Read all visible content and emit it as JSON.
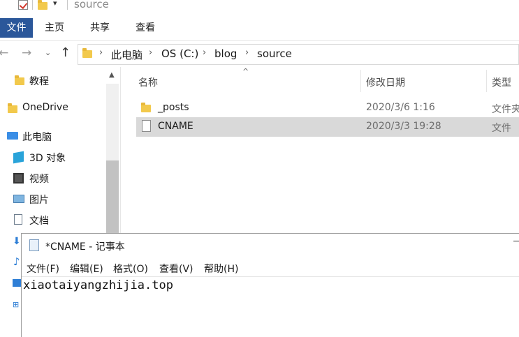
{
  "titlebar": {
    "text": "source"
  },
  "ribbon": {
    "tabs": [
      "文件",
      "主页",
      "共享",
      "查看"
    ]
  },
  "address": {
    "crumbs": [
      "此电脑",
      "OS (C:)",
      "blog",
      "source"
    ]
  },
  "nav": {
    "items": [
      "教程",
      "OneDrive",
      "此电脑",
      "3D 对象",
      "视频",
      "图片",
      "文档"
    ]
  },
  "list": {
    "columns": [
      "名称",
      "修改日期",
      "类型"
    ],
    "rows": [
      {
        "name": "_posts",
        "date": "2020/3/6 1:16",
        "type": "文件夹"
      },
      {
        "name": "CNAME",
        "date": "2020/3/3 19:28",
        "type": "文件"
      }
    ]
  },
  "notepad": {
    "title": "*CNAME - 记事本",
    "menu": [
      "文件(F)",
      "编辑(E)",
      "格式(O)",
      "查看(V)",
      "帮助(H)"
    ],
    "content": "xiaotaiyangzhijia.top"
  },
  "colors": {
    "ribbon_accent": "#2b579a",
    "selection": "#d9d9d9",
    "folder": "#f2c94c"
  }
}
